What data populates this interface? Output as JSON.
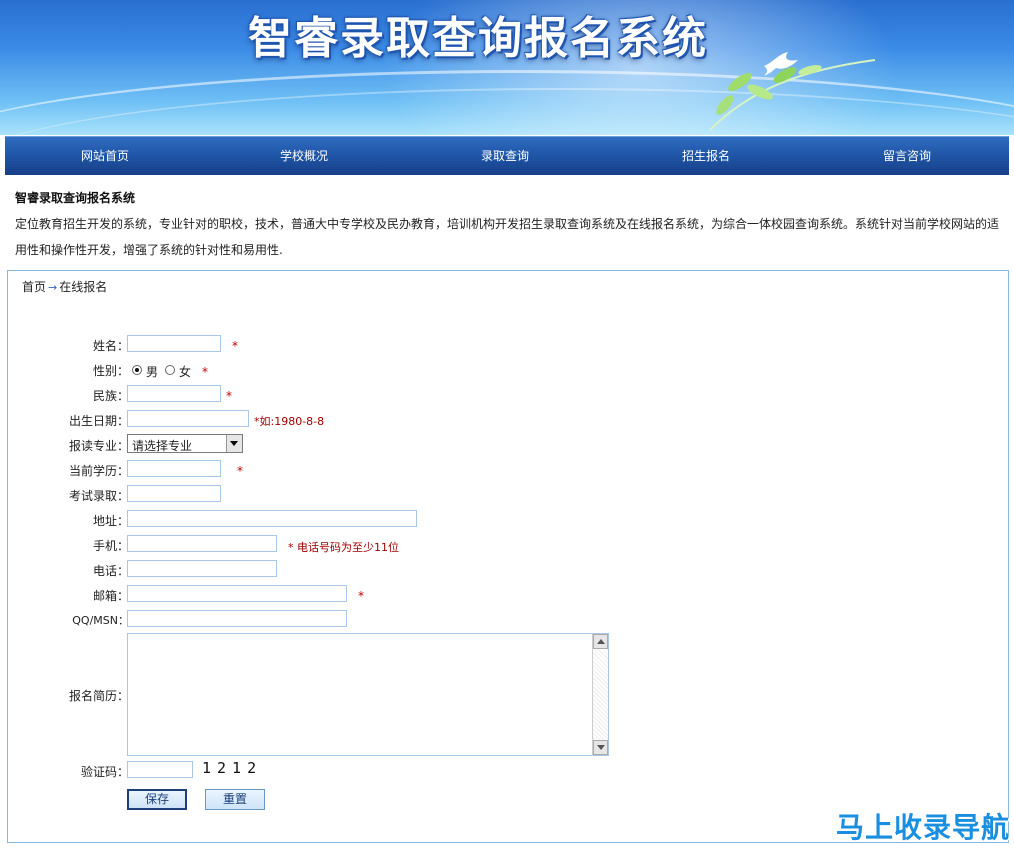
{
  "banner": {
    "title": "智睿录取查询报名系统"
  },
  "nav": {
    "items": [
      {
        "label": "网站首页"
      },
      {
        "label": "学校概况"
      },
      {
        "label": "录取查询"
      },
      {
        "label": "招生报名"
      },
      {
        "label": "留言咨询"
      }
    ]
  },
  "intro": {
    "title": "智睿录取查询报名系统",
    "text": "定位教育招生开发的系统，专业针对的职校，技术，普通大中专学校及民办教育，培训机构开发招生录取查询系统及在线报名系统，为综合一体校园查询系统。系统针对当前学校网站的适用性和操作性开发，增强了系统的针对性和易用性."
  },
  "breadcrumb": {
    "home": "首页",
    "arrow": "→",
    "current": "在线报名"
  },
  "form": {
    "required_mark": "*",
    "name": {
      "label": "姓名：",
      "value": ""
    },
    "gender": {
      "label": "性别：",
      "options": [
        "男",
        "女"
      ],
      "selected": "男"
    },
    "ethnicity": {
      "label": "民族：",
      "value": ""
    },
    "birth": {
      "label": "出生日期：",
      "value": "",
      "hint": "*如:1980-8-8"
    },
    "major": {
      "label": "报读专业：",
      "selected": "请选择专业"
    },
    "education": {
      "label": "当前学历：",
      "value": ""
    },
    "exam": {
      "label": "考试录取：",
      "value": ""
    },
    "address": {
      "label": "地址：",
      "value": ""
    },
    "mobile": {
      "label": "手机：",
      "value": "",
      "hint": "* 电话号码为至少11位"
    },
    "phone": {
      "label": "电话：",
      "value": ""
    },
    "email": {
      "label": "邮箱：",
      "value": ""
    },
    "qq": {
      "label": "QQ/MSN：",
      "value": ""
    },
    "resume": {
      "label": "报名简历：",
      "value": ""
    },
    "captcha": {
      "label": "验证码：",
      "value": "",
      "code": "1212"
    },
    "buttons": {
      "save": "保存",
      "reset": "重置"
    }
  },
  "watermark": "马上收录导航"
}
